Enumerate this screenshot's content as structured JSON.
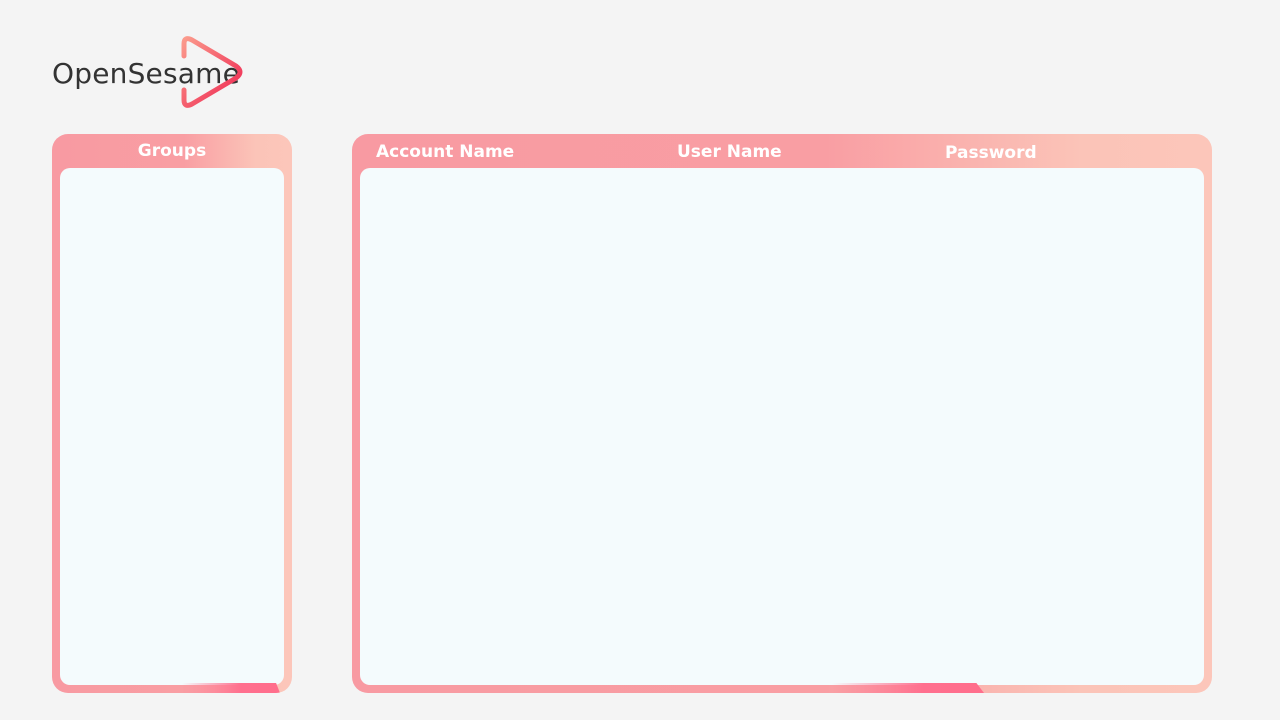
{
  "app": {
    "name": "OpenSesame",
    "brand_colors": {
      "logo_text": "#333333",
      "logo_gradient_start": "#fb8f88",
      "logo_gradient_end": "#f0284f",
      "panel_gradient_start": "#f89aa2",
      "panel_gradient_end": "#fcc6ba",
      "panel_body": "#f4fbfd"
    }
  },
  "logo": {
    "text": "OpenSesame",
    "icon": "play-triangle-icon"
  },
  "groups_panel": {
    "header": "Groups",
    "items": []
  },
  "accounts_panel": {
    "columns": [
      "Account Name",
      "User Name",
      "Password"
    ],
    "rows": []
  }
}
